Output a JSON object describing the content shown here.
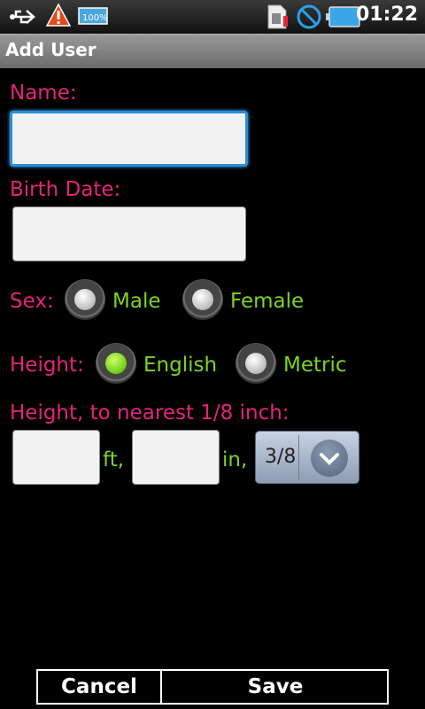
{
  "status_bar": {
    "time": "01:22",
    "battery_percent_label": "100%",
    "icons": [
      "usb-icon",
      "warning-icon",
      "battery-status-icon",
      "sim-icon",
      "no-signal-icon",
      "battery-icon"
    ]
  },
  "window": {
    "title": "Add User"
  },
  "form": {
    "name_label": "Name:",
    "name_value": "",
    "birth_label": "Birth Date:",
    "birth_value": "",
    "sex_label": "Sex:",
    "sex_options": [
      "Male",
      "Female"
    ],
    "height_label": "Height:",
    "height_options": [
      "English",
      "Metric"
    ],
    "height_selected": "English",
    "height_inch_label": "Height, to nearest 1/8 inch:",
    "feet_value": "",
    "feet_unit": "ft,",
    "inches_value": "",
    "inches_unit": "in,",
    "fraction_value": "3/8"
  },
  "buttons": {
    "cancel": "Cancel",
    "save": "Save"
  },
  "colors": {
    "label": "#e6237a",
    "option": "#7ed321",
    "focus": "#2a8fd8"
  }
}
